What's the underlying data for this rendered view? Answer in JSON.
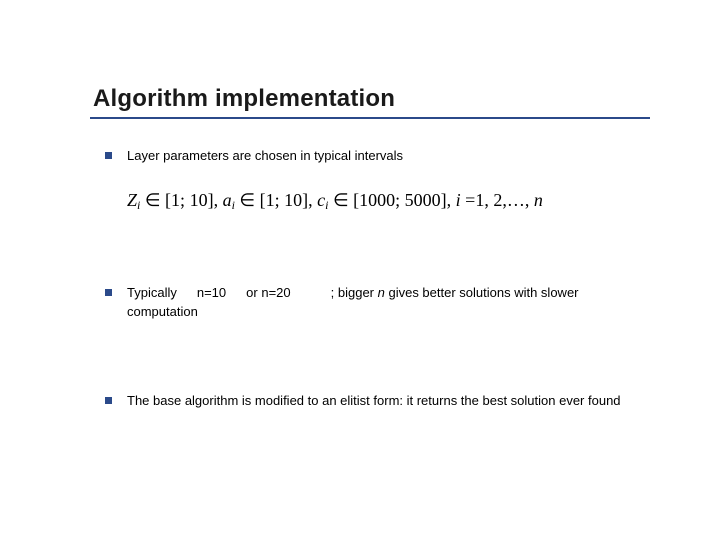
{
  "title": "Algorithm implementation",
  "bullets": {
    "b1": "Layer parameters are chosen in typical intervals",
    "b2_pre": "Typically",
    "b2_n10": "n=10",
    "b2_or": "or",
    "b2_n20": "n=20",
    "b2_rest_a": "; bigger ",
    "b2_rest_n": "n",
    "b2_rest_b": " gives better solutions with slower",
    "b2_line2": "computation",
    "b3": "The base algorithm is modified to an elitist form: it returns the best solution ever found"
  },
  "formula": {
    "Z": "Z",
    "i": "i",
    "in": "∈",
    "lb": "[",
    "rb": "]",
    "sc": ";",
    "one": "1",
    "ten": "10",
    "a": "a",
    "c": "c",
    "thousand": "1000",
    "fivethousand": "5000",
    "comma": ",",
    "eq": "=",
    "two": "2",
    "dots": "…",
    "n": "n"
  }
}
